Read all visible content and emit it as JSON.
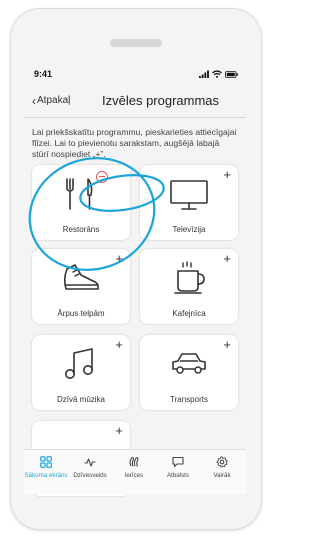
{
  "status": {
    "time": "9:41"
  },
  "header": {
    "back_label": "Atpakaļ",
    "title": "Izvēles programmas"
  },
  "description": "Lai priekšskatītu programmu, pieskarieties attiecīgajai flīzei. Lai to pievienotu sarakstam, augšējā labajā stūrī nospiediet „+”.",
  "tiles": [
    {
      "label": "Restorāns",
      "icon": "cutlery-icon",
      "action": "minus"
    },
    {
      "label": "Televīzija",
      "icon": "tv-icon",
      "action": "+"
    },
    {
      "label": "Ārpus telpām",
      "icon": "shoe-icon",
      "action": "+"
    },
    {
      "label": "Kafejnīca",
      "icon": "coffee-cup-icon",
      "action": "+"
    },
    {
      "label": "Dzīvā mūzika",
      "icon": "music-note-icon",
      "action": "+"
    },
    {
      "label": "Transports",
      "icon": "car-icon",
      "action": "+"
    },
    {
      "label": "",
      "icon": "",
      "action": "+"
    }
  ],
  "nav": [
    {
      "label": "Sākuma ekrāns",
      "icon": "grid-icon",
      "active": true
    },
    {
      "label": "Dzīvesveids",
      "icon": "activity-icon",
      "active": false
    },
    {
      "label": "Ierīces",
      "icon": "hearing-aids-icon",
      "active": false
    },
    {
      "label": "Atbalsts",
      "icon": "chat-bubble-icon",
      "active": false
    },
    {
      "label": "Vairāk",
      "icon": "gear-icon",
      "active": false
    }
  ],
  "colors": {
    "accent": "#1aa5d8",
    "remove": "#e05a5a",
    "annotation": "#1aa5d8"
  }
}
